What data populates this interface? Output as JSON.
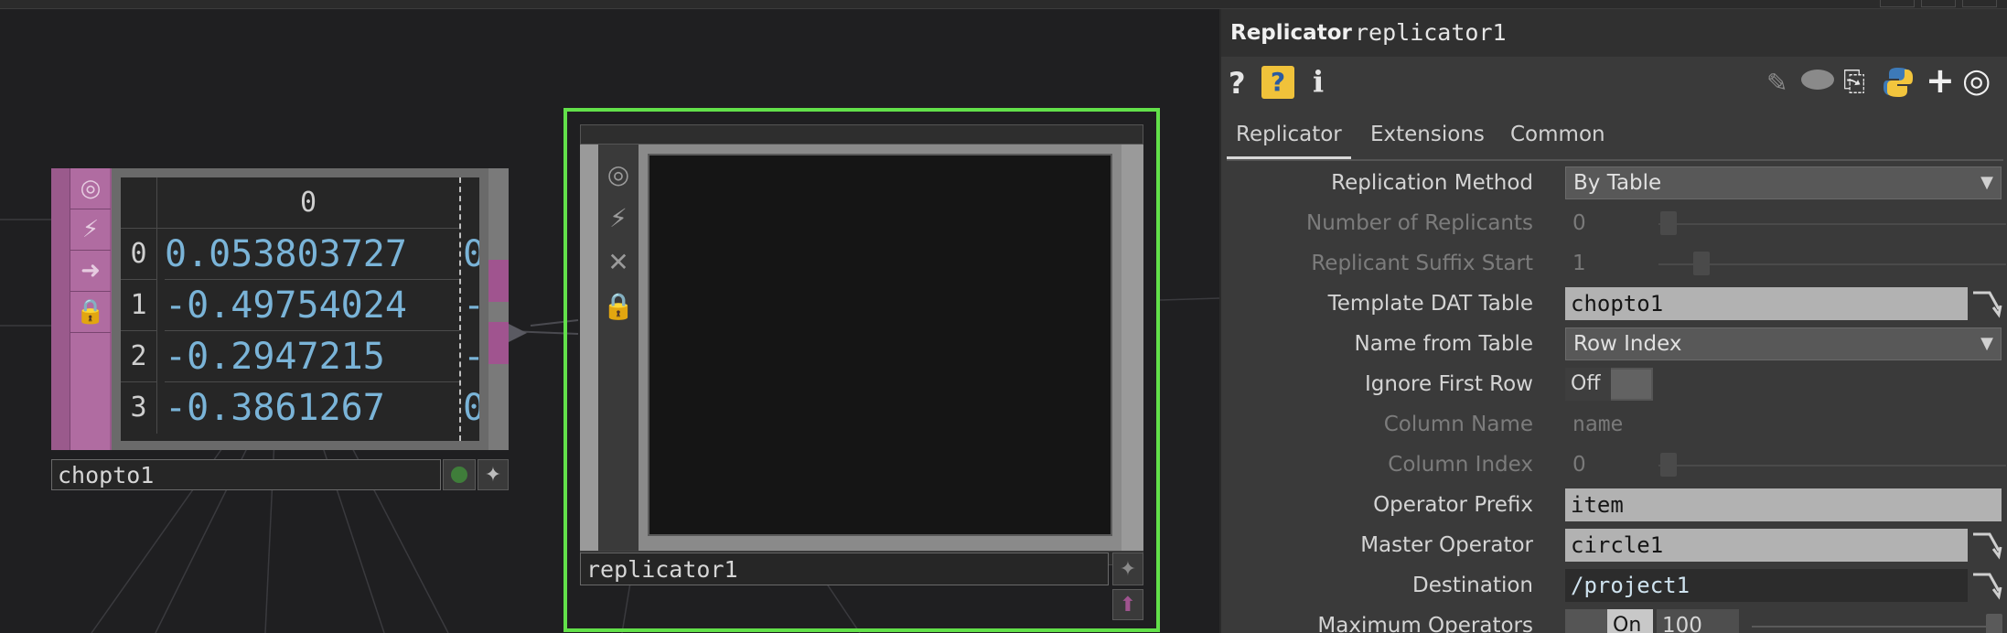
{
  "window": {
    "title": "replicator1"
  },
  "chop_node": {
    "name": "chopto1",
    "column_header": "0",
    "rows": [
      {
        "index": "0",
        "value": "0.053803727",
        "next": "0"
      },
      {
        "index": "1",
        "value": "-0.49754024",
        "next": "-"
      },
      {
        "index": "2",
        "value": "-0.2947215",
        "next": "-"
      },
      {
        "index": "3",
        "value": "-0.3861267",
        "next": "0"
      }
    ]
  },
  "rep_node": {
    "name": "replicator1"
  },
  "panel": {
    "op_type": "Replicator",
    "op_name": "replicator1",
    "icons": {
      "help": "?",
      "python_help": "?",
      "info": "i"
    },
    "tabs": [
      "Replicator",
      "Extensions",
      "Common"
    ],
    "active_tab": "Replicator",
    "params": {
      "replication_method": {
        "label": "Replication Method",
        "value": "By Table"
      },
      "number_of_replicants": {
        "label": "Number of Replicants",
        "value": "0"
      },
      "replicant_suffix_start": {
        "label": "Replicant Suffix Start",
        "value": "1"
      },
      "template_dat_table": {
        "label": "Template DAT Table",
        "value": "chopto1"
      },
      "name_from_table": {
        "label": "Name from Table",
        "value": "Row Index"
      },
      "ignore_first_row": {
        "label": "Ignore First Row",
        "value": "Off"
      },
      "column_name": {
        "label": "Column Name",
        "value": "name"
      },
      "column_index": {
        "label": "Column Index",
        "value": "0"
      },
      "operator_prefix": {
        "label": "Operator Prefix",
        "value": "item"
      },
      "master_operator": {
        "label": "Master Operator",
        "value": "circle1"
      },
      "destination": {
        "label": "Destination",
        "value": "/project1"
      },
      "maximum_operators": {
        "label": "Maximum Operators",
        "toggle": "On",
        "value": "100"
      }
    }
  },
  "colors": {
    "selected_outline": "#62e04a",
    "chop_accent": "#9a5a8c",
    "table_value": "#7ab4d8",
    "panel_bg": "#3a3a3a"
  }
}
